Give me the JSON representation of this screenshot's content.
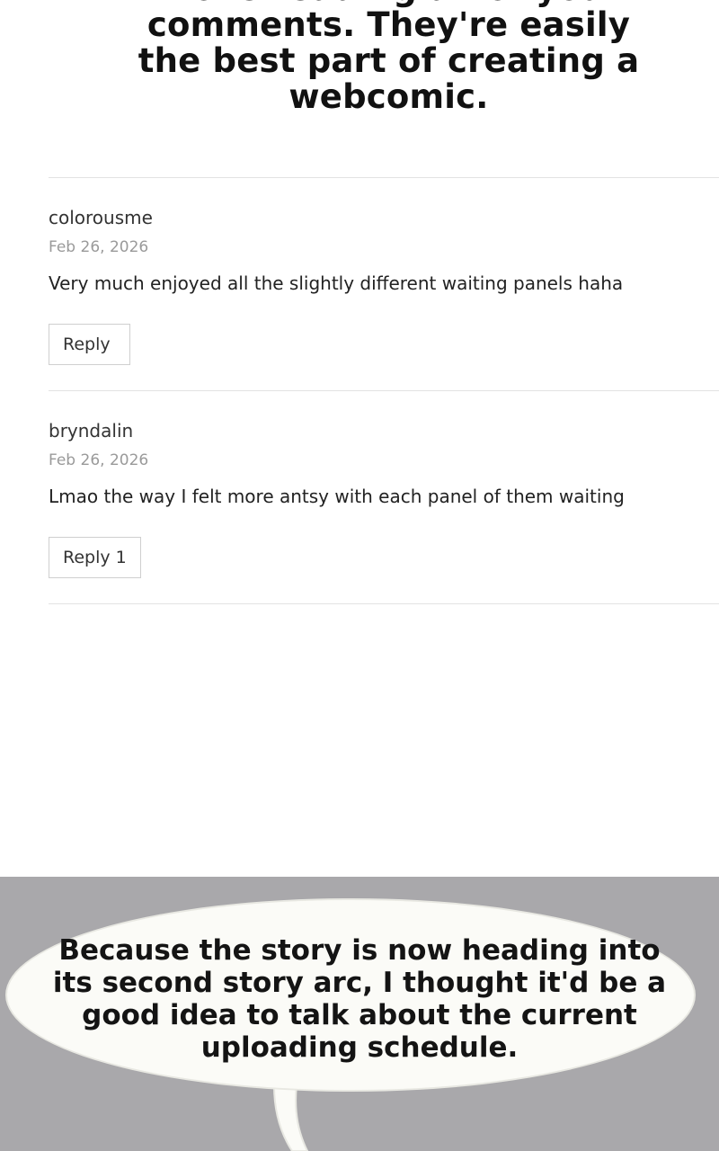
{
  "top_panel": {
    "text": "I love reading all of your comments. They're easily the best part of creating a webcomic."
  },
  "comments": [
    {
      "author": "colorousme",
      "date": "Feb 26, 2026",
      "body": "Very much enjoyed all the slightly different waiting panels haha",
      "reply_label": "Reply",
      "reply_count": ""
    },
    {
      "author": "bryndalin",
      "date": "Feb 26, 2026",
      "body": "Lmao the way I felt more antsy with each panel of them waiting",
      "reply_label": "Reply",
      "reply_count": "1"
    }
  ],
  "bottom_panel": {
    "text": "Because the story is now heading into its second story arc, I thought it'd be a good idea to talk about the current uploading schedule."
  },
  "colors": {
    "panel_background": "#a9a8ab",
    "bubble_fill": "#fbfbf7",
    "divider": "#e3e3e3",
    "date_text": "#9a9a9a"
  }
}
